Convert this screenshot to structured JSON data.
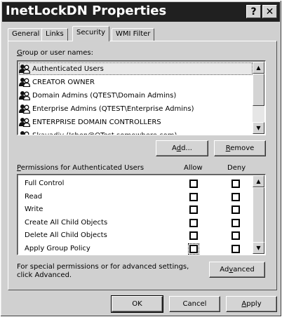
{
  "window": {
    "title": "InetLockDN Properties",
    "help_label": "?",
    "close_label": "✕"
  },
  "tabs": [
    {
      "label": "General",
      "active": false
    },
    {
      "label": "Links",
      "active": false
    },
    {
      "label": "Security",
      "active": true
    },
    {
      "label": "WMI Filter",
      "active": false
    }
  ],
  "groups": {
    "label_prefix": "G",
    "label_rest": "roup or user names:",
    "items": [
      "Authenticated Users",
      "CREATOR OWNER",
      "Domain Admins (QTEST\\Domain Admins)",
      "Enterprise Admins (QTEST\\Enterprise Admins)",
      "ENTERPRISE DOMAIN CONTROLLERS",
      "Skavadiy (Ishen@QTest.somewhere.com)"
    ],
    "selected_index": 0
  },
  "buttons": {
    "add": {
      "prefix": "A",
      "ul": "d",
      "suffix": "d..."
    },
    "remove": {
      "ul": "R",
      "suffix": "emove"
    },
    "advanced": {
      "prefix": "Ad",
      "ul": "v",
      "suffix": "anced"
    },
    "ok": "OK",
    "cancel": "Cancel",
    "apply": {
      "ul": "A",
      "suffix": "pply"
    }
  },
  "permissions": {
    "label_ul": "P",
    "label_rest": "ermissions for Authenticated Users",
    "allow_header": "Allow",
    "deny_header": "Deny",
    "rows": [
      {
        "name": "Full Control",
        "allow": false,
        "deny": false
      },
      {
        "name": "Read",
        "allow": false,
        "deny": false
      },
      {
        "name": "Write",
        "allow": false,
        "deny": false
      },
      {
        "name": "Create All Child Objects",
        "allow": false,
        "deny": false
      },
      {
        "name": "Delete All Child Objects",
        "allow": false,
        "deny": false
      },
      {
        "name": "Apply Group Policy",
        "allow": false,
        "deny": false
      }
    ]
  },
  "advanced_note": {
    "line1": "For special permissions or for advanced settings,",
    "line2": "click Advanced."
  },
  "colors": {
    "titlebar": "#202020",
    "face": "#d0d0d0"
  }
}
